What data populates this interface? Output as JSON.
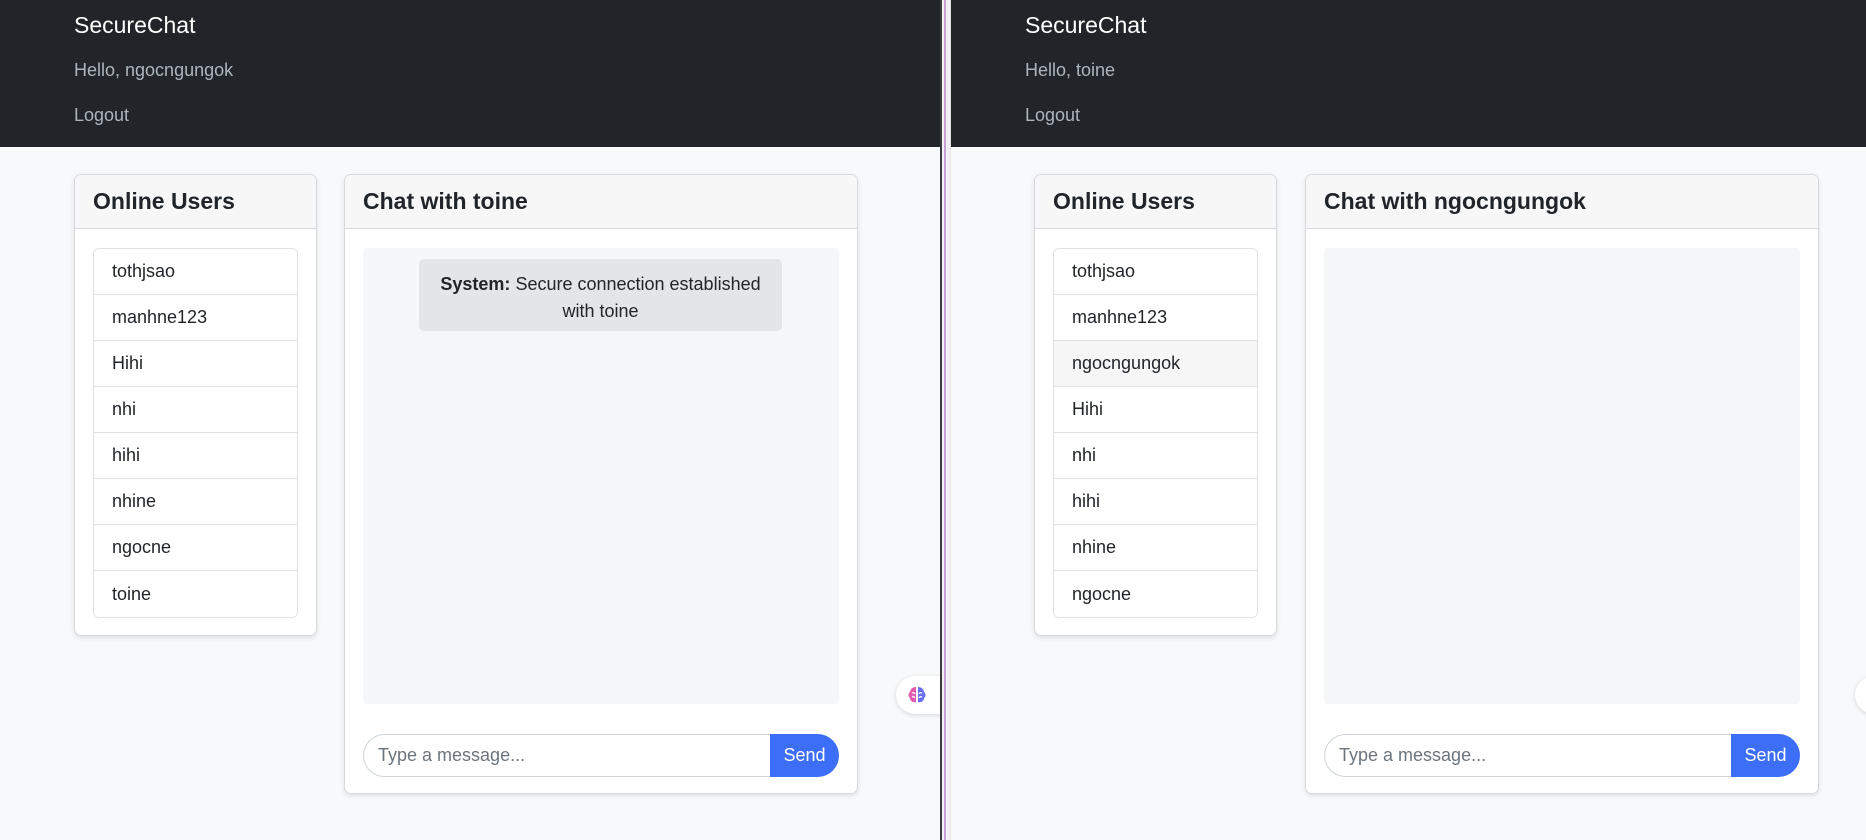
{
  "left_window": {
    "navbar": {
      "brand": "SecureChat",
      "greeting": "Hello, ngocngungok",
      "logout": "Logout"
    },
    "users_panel": {
      "title": "Online Users",
      "users": [
        "tothjsao",
        "manhne123",
        "Hihi",
        "nhi",
        "hihi",
        "nhine",
        "ngocne",
        "toine"
      ]
    },
    "chat_panel": {
      "title": "Chat with toine",
      "messages": [
        {
          "sender": "System:",
          "text": "Secure connection established with toine"
        }
      ],
      "input_placeholder": "Type a message...",
      "send_label": "Send"
    }
  },
  "right_window": {
    "navbar": {
      "brand": "SecureChat",
      "greeting": "Hello, toine",
      "logout": "Logout"
    },
    "users_panel": {
      "title": "Online Users",
      "users": [
        "tothjsao",
        "manhne123",
        "ngocngungok",
        "Hihi",
        "nhi",
        "hihi",
        "nhine",
        "ngocne"
      ]
    },
    "chat_panel": {
      "title": "Chat with ngocngungok",
      "messages": [],
      "input_placeholder": "Type a message...",
      "send_label": "Send"
    }
  },
  "colors": {
    "navbar_bg": "#212529",
    "page_bg": "#f8f9fa",
    "send_button": "#3d6ef7",
    "system_message_bg": "#e4e5e7"
  },
  "icons": {
    "extension_badge": "brain-icon"
  }
}
